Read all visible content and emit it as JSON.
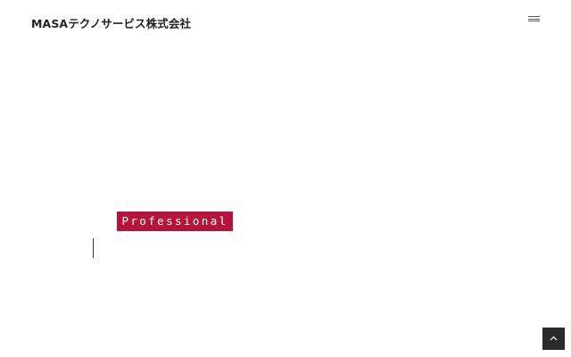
{
  "header": {
    "site_title": "MASAテクノサービス株式会社",
    "menu_icon": "hamburger-menu-icon"
  },
  "hero": {
    "tag_label": "Professional",
    "accent_color": "#b5153b"
  },
  "back_to_top": {
    "icon": "chevron-up-icon",
    "background": "#2a2a2a"
  }
}
